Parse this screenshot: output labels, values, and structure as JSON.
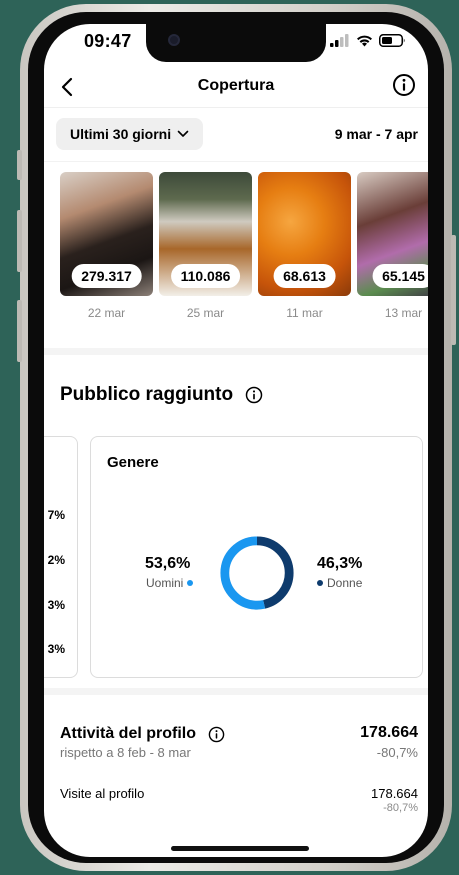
{
  "status_bar": {
    "time": "09:47"
  },
  "header": {
    "title": "Copertura"
  },
  "period": {
    "selected": "Ultimi 30 giorni",
    "range": "9 mar - 7 apr"
  },
  "posts": [
    {
      "count": "279.317",
      "date": "22 mar"
    },
    {
      "count": "110.086",
      "date": "25 mar"
    },
    {
      "count": "68.613",
      "date": "11 mar"
    },
    {
      "count": "65.145",
      "date": "13 mar"
    }
  ],
  "audience": {
    "title": "Pubblico raggiunto",
    "prev_card_values": [
      "7%",
      "2%",
      "3%",
      "3%"
    ],
    "gender": {
      "title": "Genere",
      "male": {
        "pct": "53,6%",
        "label": "Uomini",
        "value": 53.6
      },
      "female": {
        "pct": "46,3%",
        "label": "Donne",
        "value": 46.3
      }
    }
  },
  "activity": {
    "title": "Attività del profilo",
    "subtitle": "rispetto a 8 feb - 8 mar",
    "total": "178.664",
    "change": "-80,7%",
    "visits": {
      "label": "Visite al profilo",
      "value": "178.664",
      "change": "-80,7%"
    }
  },
  "colors": {
    "male": "#1a97f0",
    "female": "#0e3b6d",
    "background": "#2e6358"
  },
  "icons": [
    "back-chevron-icon",
    "info-icon",
    "chevron-down-icon",
    "signal-icon",
    "wifi-icon",
    "battery-icon"
  ]
}
